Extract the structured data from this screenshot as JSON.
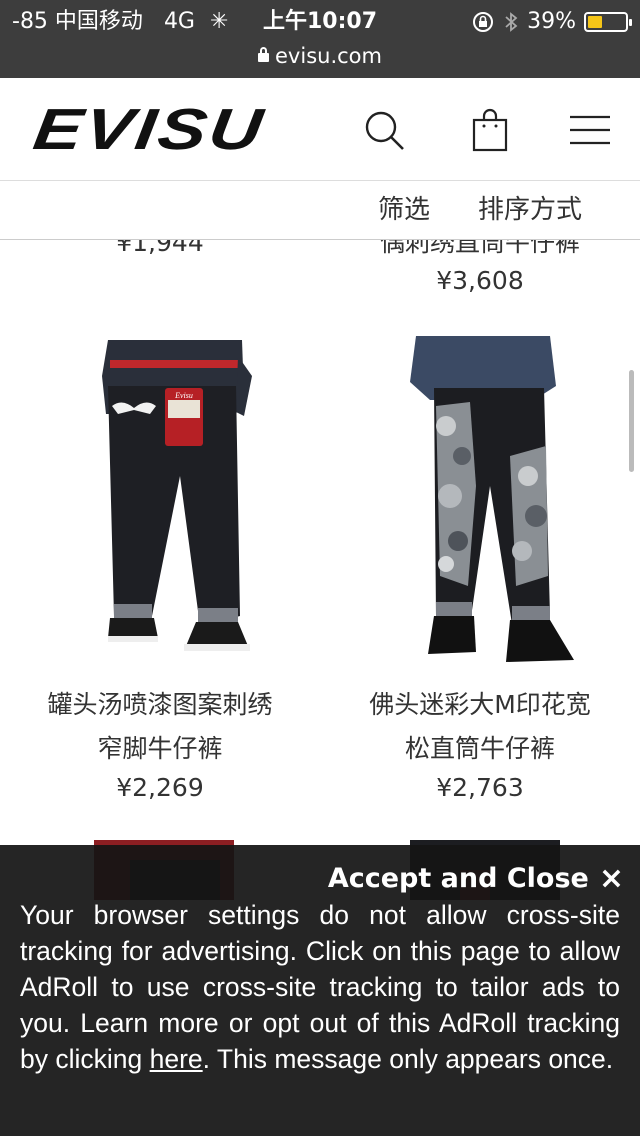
{
  "status_bar": {
    "signal": "-85 中国移动",
    "network": "4G",
    "time": "上午10:07",
    "battery": "39%",
    "battery_level": 0.39
  },
  "browser": {
    "url": "evisu.com"
  },
  "header": {
    "logo": "EVISU",
    "icons": [
      "search-icon",
      "shopping-bag-icon",
      "menu-icon"
    ]
  },
  "filter_bar": {
    "filter_label": "筛选",
    "sort_label": "排序方式"
  },
  "products_partial": [
    {
      "name_tail": "",
      "price": "¥1,944"
    },
    {
      "name_tail": "偶刺绣直筒牛仔裤",
      "price": "¥3,608"
    }
  ],
  "products": [
    {
      "name_line1": "罐头汤喷漆图案刺绣",
      "name_line2": "窄脚牛仔裤",
      "price": "¥2,269"
    },
    {
      "name_line1": "佛头迷彩大M印花宽",
      "name_line2": "松直筒牛仔裤",
      "price": "¥2,763"
    }
  ],
  "consent": {
    "accept_label": "Accept and Close",
    "close_symbol": "×",
    "message_before_link": "Your browser settings do not allow cross-site tracking for advertising. Click on this page to allow AdRoll to use cross-site tracking to tailor ads to you. Learn more or opt out of this AdRoll tracking by clicking ",
    "link_text": "here",
    "message_after_link": ". This message only appears once."
  },
  "colors": {
    "status_bg": "#3d3d3d",
    "battery_fill": "#f5c518",
    "overlay_bg": "#141414"
  }
}
